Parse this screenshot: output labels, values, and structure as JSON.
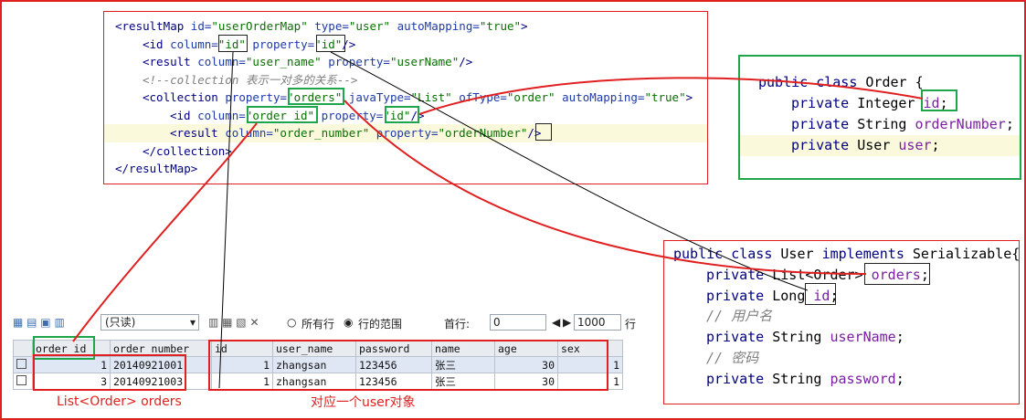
{
  "mapper": {
    "lines": [
      {
        "parts": [
          [
            "tag",
            "<resultMap "
          ],
          [
            "attr",
            "id="
          ],
          [
            "str",
            "\"userOrderMap\""
          ],
          [
            "attr",
            " type="
          ],
          [
            "str",
            "\"user\""
          ],
          [
            "attr",
            " autoMapping="
          ],
          [
            "str",
            "\"true\""
          ],
          [
            "tag",
            ">"
          ]
        ]
      },
      {
        "parts": [
          [
            "tag",
            "<id "
          ],
          [
            "attr",
            "column="
          ],
          [
            "str",
            "\"id\""
          ],
          [
            "attr",
            " property="
          ],
          [
            "str",
            "\"id\""
          ],
          [
            "tag",
            "/>"
          ]
        ]
      },
      {
        "parts": [
          [
            "tag",
            "<result "
          ],
          [
            "attr",
            "column="
          ],
          [
            "str",
            "\"user_name\""
          ],
          [
            "attr",
            " property="
          ],
          [
            "str",
            "\"userName\""
          ],
          [
            "tag",
            "/>"
          ]
        ]
      },
      {
        "parts": [
          [
            "cmt",
            "<!--collection 表示一对多的关系-->"
          ]
        ]
      },
      {
        "parts": [
          [
            "tag",
            "<collection "
          ],
          [
            "attr",
            "property="
          ],
          [
            "str",
            "\"orders\""
          ],
          [
            "attr",
            " javaType="
          ],
          [
            "str",
            "\"List\""
          ],
          [
            "attr",
            " ofType="
          ],
          [
            "str",
            "\"order\""
          ],
          [
            "attr",
            " autoMapping="
          ],
          [
            "str",
            "\"true\""
          ],
          [
            "tag",
            ">"
          ]
        ]
      },
      {
        "parts": [
          [
            "tag",
            "<id "
          ],
          [
            "attr",
            "column="
          ],
          [
            "str",
            "\"order_id\""
          ],
          [
            "attr",
            " property="
          ],
          [
            "str",
            "\"id\""
          ],
          [
            "tag",
            "/>"
          ]
        ]
      },
      {
        "parts": [
          [
            "tag",
            "<result "
          ],
          [
            "attr",
            "column="
          ],
          [
            "str",
            "\"order_number\""
          ],
          [
            "attr",
            " property="
          ],
          [
            "str",
            "\"orderNumber\""
          ],
          [
            "tag",
            "/>"
          ]
        ]
      },
      {
        "parts": [
          [
            "tag",
            "</collection>"
          ]
        ]
      },
      {
        "parts": [
          [
            "tag",
            "</resultMap>"
          ]
        ]
      }
    ]
  },
  "order_class": {
    "lines": [
      {
        "parts": [
          [
            "kw",
            "public class "
          ],
          [
            "plain",
            "Order {"
          ]
        ]
      },
      {
        "parts": [
          [
            "kw",
            "private "
          ],
          [
            "plain",
            "Integer "
          ],
          [
            "fld",
            "id"
          ],
          [
            "plain",
            ";"
          ]
        ]
      },
      {
        "parts": [
          [
            "kw",
            "private "
          ],
          [
            "plain",
            "String "
          ],
          [
            "fld",
            "orderNumber"
          ],
          [
            "plain",
            ";"
          ]
        ]
      },
      {
        "parts": [
          [
            "kw",
            "private "
          ],
          [
            "plain",
            "User "
          ],
          [
            "fld",
            "user"
          ],
          [
            "plain",
            ";"
          ]
        ]
      }
    ]
  },
  "user_class": {
    "lines": [
      {
        "parts": [
          [
            "kw",
            "public class "
          ],
          [
            "plain",
            "User "
          ],
          [
            "kw",
            "implements "
          ],
          [
            "plain",
            "Serializable{"
          ]
        ]
      },
      {
        "parts": [
          [
            "kw",
            "private "
          ],
          [
            "plain",
            "List<Order> "
          ],
          [
            "fld",
            "orders"
          ],
          [
            "plain",
            ";"
          ]
        ]
      },
      {
        "parts": [
          [
            "kw",
            "private "
          ],
          [
            "plain",
            "Long "
          ],
          [
            "fld",
            "id"
          ],
          [
            "plain",
            ";"
          ]
        ]
      },
      {
        "parts": [
          [
            "cm2",
            "// 用户名"
          ]
        ]
      },
      {
        "parts": [
          [
            "kw",
            "private "
          ],
          [
            "plain",
            "String "
          ],
          [
            "fld",
            "userName"
          ],
          [
            "plain",
            ";"
          ]
        ]
      },
      {
        "parts": [
          [
            "cm2",
            "// 密码"
          ]
        ]
      },
      {
        "parts": [
          [
            "kw",
            "private "
          ],
          [
            "plain",
            "String "
          ],
          [
            "fld",
            "password"
          ],
          [
            "plain",
            ";"
          ]
        ]
      }
    ]
  },
  "toolbar": {
    "readonly_label": "(只读)",
    "all_rows_label": "所有行",
    "row_range_label": "行的范围",
    "start_row_label": "首行:",
    "start_row_value": "0",
    "row_count_value": "1000",
    "row_suffix": "行"
  },
  "grid": {
    "columns": [
      "order_id",
      "order_number",
      "id",
      "user_name",
      "password",
      "name",
      "age",
      "sex"
    ],
    "rows": [
      [
        "1",
        "20140921001",
        "1",
        "zhangsan",
        "123456",
        "张三",
        "30",
        "1"
      ],
      [
        "3",
        "20140921003",
        "1",
        "zhangsan",
        "123456",
        "张三",
        "30",
        "1"
      ]
    ]
  },
  "captions": {
    "orders_list": "List<Order> orders",
    "user_object": "对应一个user对象"
  },
  "colors": {
    "frame_red": "#e02020",
    "box_green": "#1fa64a"
  }
}
